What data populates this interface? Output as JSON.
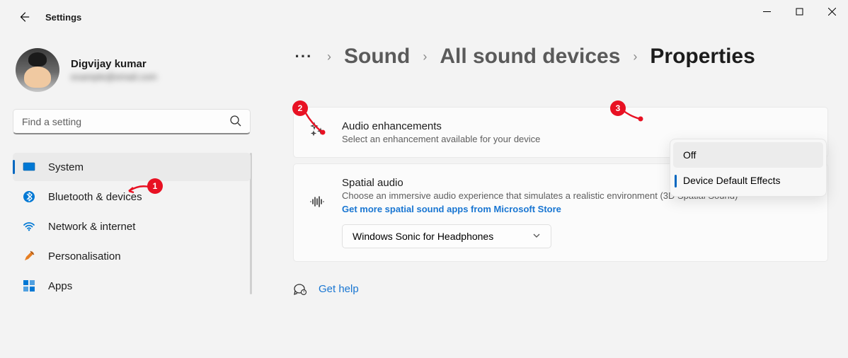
{
  "window": {
    "app_title": "Settings"
  },
  "user": {
    "display_name": "Digvijay kumar"
  },
  "search": {
    "placeholder": "Find a setting"
  },
  "sidebar": {
    "items": [
      {
        "label": "System",
        "icon": "system-icon",
        "selected": true
      },
      {
        "label": "Bluetooth & devices",
        "icon": "bluetooth-icon",
        "selected": false
      },
      {
        "label": "Network & internet",
        "icon": "wifi-icon",
        "selected": false
      },
      {
        "label": "Personalisation",
        "icon": "brush-icon",
        "selected": false
      },
      {
        "label": "Apps",
        "icon": "apps-icon",
        "selected": false
      }
    ]
  },
  "breadcrumb": {
    "items": [
      "Sound",
      "All sound devices",
      "Properties"
    ]
  },
  "cards": {
    "audio_enhancements": {
      "title": "Audio enhancements",
      "desc": "Select an enhancement available for your device",
      "dropdown": {
        "options": [
          "Off",
          "Device Default Effects"
        ],
        "selected_index": 1
      }
    },
    "spatial_audio": {
      "title": "Spatial audio",
      "desc": "Choose an immersive audio experience that simulates a realistic environment (3D Spatial Sound)",
      "link": "Get more spatial sound apps from Microsoft Store",
      "select_value": "Windows Sonic for Headphones"
    }
  },
  "help": {
    "label": "Get help"
  },
  "annotations": [
    {
      "n": "1"
    },
    {
      "n": "2"
    },
    {
      "n": "3"
    }
  ]
}
